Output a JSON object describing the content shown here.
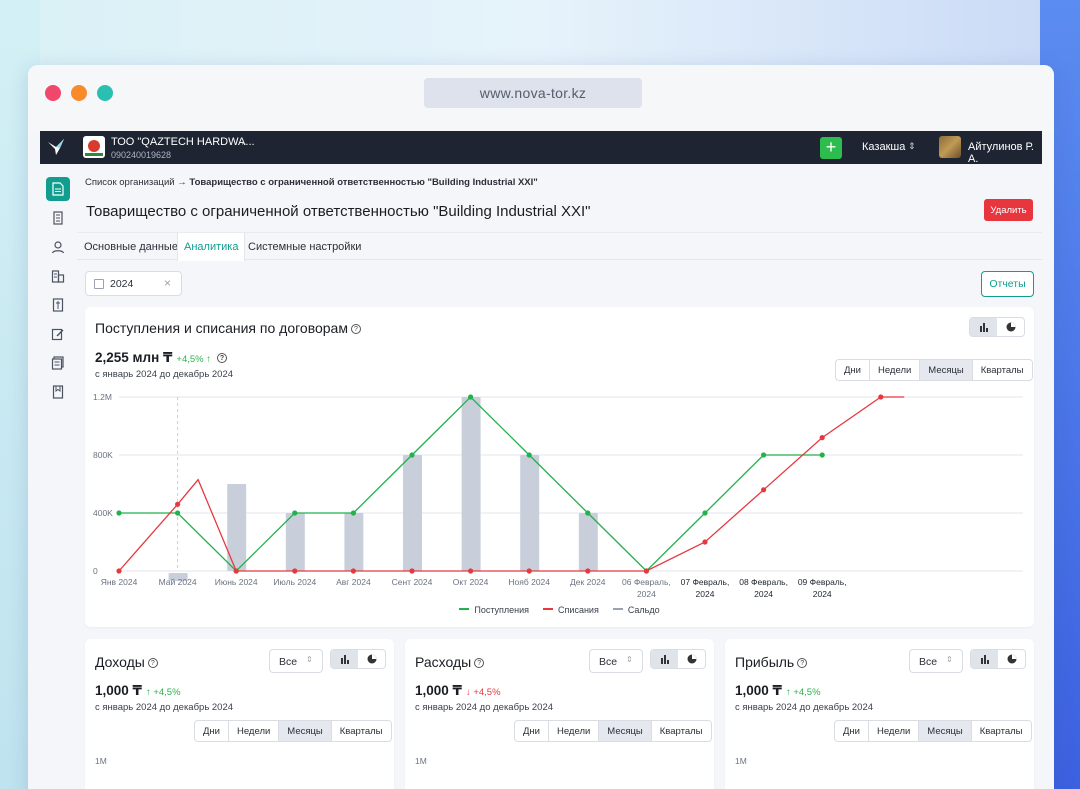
{
  "browser": {
    "url": "www.nova-tor.kz"
  },
  "topbar": {
    "org_name": "ТОО \"QAZTECH HARDWA...",
    "org_id": "090240019628",
    "language": "Казакша",
    "user": "Айтулинов Р. А."
  },
  "sidebar": {
    "items": [
      "document-icon",
      "ledger-icon",
      "user-icon",
      "building-icon",
      "contract-icon",
      "edit-icon",
      "list-icon",
      "book-icon"
    ]
  },
  "breadcrumb": {
    "parent": "Список организаций",
    "arrow": "→",
    "current": "Товарищество с ограниченной ответственностью \"Building Industrial XXI\""
  },
  "page": {
    "title": "Товарищество с ограниченной ответственностью \"Building Industrial XXI\"",
    "delete_label": "Удалить",
    "reports_label": "Отчеты",
    "year": "2024"
  },
  "tabs": [
    "Основные данные",
    "Аналитика",
    "Системные настройки"
  ],
  "period_options": [
    "Дни",
    "Недели",
    "Месяцы",
    "Кварталы"
  ],
  "main_chart": {
    "title": "Поступления и списания по договорам",
    "total": "2,255 млн ₸",
    "delta": "+4,5%",
    "delta_arrow": "↑",
    "period": "с январь 2024 до декабрь 2024",
    "active_period": "Месяцы"
  },
  "chart_data": {
    "type": "line",
    "x": [
      "Янв 2024",
      "Май 2024",
      "Июнь 2024",
      "Июль 2024",
      "Авг 2024",
      "Сент 2024",
      "Окт 2024",
      "Нояб 2024",
      "Дек 2024",
      "06 Февраль, 2024",
      "07 Февраль, 2024",
      "08 Февраль, 2024",
      "09 Февраль, 2024"
    ],
    "y_ticks": [
      "0",
      "400K",
      "800K",
      "1.2M"
    ],
    "ylim": [
      0,
      1200000
    ],
    "series": [
      {
        "name": "Поступления",
        "color": "#22b14c",
        "points": [
          [
            0,
            400000
          ],
          [
            1,
            400000
          ],
          [
            2,
            0
          ],
          [
            3,
            400000
          ],
          [
            4,
            400000
          ],
          [
            5,
            800000
          ],
          [
            6,
            1200000
          ],
          [
            7,
            800000
          ],
          [
            8,
            400000
          ],
          [
            9,
            0
          ],
          [
            10,
            400000
          ],
          [
            11,
            800000
          ],
          [
            12,
            800000
          ]
        ]
      },
      {
        "name": "Списания",
        "color": "#e5393f",
        "points": [
          [
            0,
            0
          ],
          [
            1,
            460000
          ],
          [
            1.35,
            630000
          ],
          [
            2,
            0
          ],
          [
            3,
            0
          ],
          [
            4,
            0
          ],
          [
            5,
            0
          ],
          [
            6,
            0
          ],
          [
            7,
            0
          ],
          [
            8,
            0
          ],
          [
            9,
            0
          ],
          [
            10,
            200000
          ],
          [
            11,
            560000
          ],
          [
            12,
            920000
          ],
          [
            13,
            1200000
          ],
          [
            13.4,
            1200000
          ]
        ]
      },
      {
        "name": "Сальдо",
        "color": "#9aa2ae",
        "bars": [
          [
            1,
            -50000
          ],
          [
            2,
            600000
          ],
          [
            3,
            400000
          ],
          [
            4,
            400000
          ],
          [
            5,
            800000
          ],
          [
            6,
            1200000
          ],
          [
            7,
            800000
          ],
          [
            8,
            400000
          ]
        ]
      }
    ],
    "grid": true,
    "legend": "bottom"
  },
  "small_cards": [
    {
      "title": "Доходы",
      "filter": "Все",
      "total": "1,000 ₸",
      "delta": "+4,5%",
      "delta_arrow": "↑",
      "direction": "up",
      "period": "с январь 2024 до декабрь 2024",
      "axis_top": "1M"
    },
    {
      "title": "Расходы",
      "filter": "Все",
      "total": "1,000 ₸",
      "delta": "+4,5%",
      "delta_arrow": "↓",
      "direction": "down",
      "period": "с январь 2024 до декабрь 2024",
      "axis_top": "1M"
    },
    {
      "title": "Прибыль",
      "filter": "Все",
      "total": "1,000 ₸",
      "delta": "+4,5%",
      "delta_arrow": "↑",
      "direction": "up",
      "period": "с январь 2024 до декабрь 2024",
      "axis_top": "1M"
    }
  ]
}
